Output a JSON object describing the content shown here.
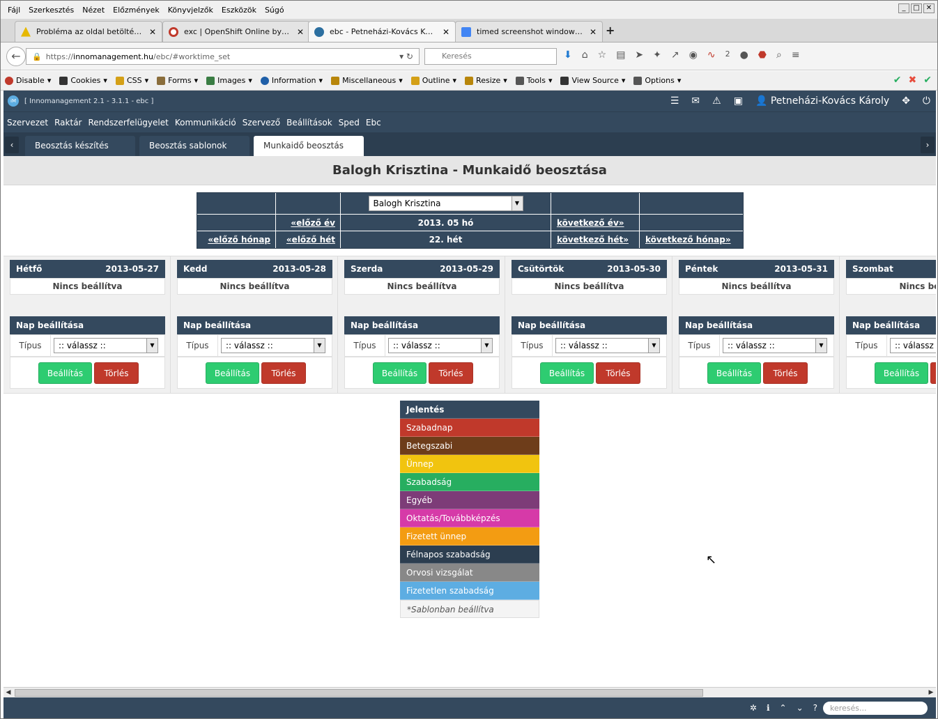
{
  "browser": {
    "menu": [
      "Fájl",
      "Szerkesztés",
      "Nézet",
      "Előzmények",
      "Könyvjelzők",
      "Eszközök",
      "Súgó"
    ],
    "tabs": [
      {
        "title": "Probléma az oldal betöltése k...",
        "icon_color": "#e6b800",
        "icon": "warning-icon"
      },
      {
        "title": "exc | OpenShift Online by Re...",
        "icon_color": "#c0392b",
        "icon": "openshift-icon"
      },
      {
        "title": "ebc - Petneházi-Kovács Károl...",
        "icon_color": "#2c6fa0",
        "icon": "innomanagement-icon"
      },
      {
        "title": "timed screenshot windows - G...",
        "icon_color": "#4285f4",
        "icon": "google-icon"
      }
    ],
    "new_tab": "+",
    "url_prefix": "https://",
    "url_domain": "innomanagement.hu",
    "url_path": "/ebc/#worktime_set",
    "search_placeholder": "Keresés",
    "nav_badge": "2"
  },
  "webdev": [
    {
      "label": "Disable",
      "color": "#c0392b"
    },
    {
      "label": "Cookies",
      "color": "#333333"
    },
    {
      "label": "CSS",
      "color": "#d4a017"
    },
    {
      "label": "Forms",
      "color": "#8a6d3b"
    },
    {
      "label": "Images",
      "color": "#3a7d44"
    },
    {
      "label": "Information",
      "color": "#1f5fa8"
    },
    {
      "label": "Miscellaneous",
      "color": "#b8860b"
    },
    {
      "label": "Outline",
      "color": "#d4a017"
    },
    {
      "label": "Resize",
      "color": "#b8860b"
    },
    {
      "label": "Tools",
      "color": "#555555"
    },
    {
      "label": "View Source",
      "color": "#333333"
    },
    {
      "label": "Options",
      "color": "#555555"
    }
  ],
  "app": {
    "version": "[ Innomanagement 2.1 - 3.1.1 - ebc ]",
    "logo": "iM",
    "user": "Petneházi-Kovács Károly",
    "menu": [
      "Szervezet",
      "Raktár",
      "Rendszerfelügyelet",
      "Kommunikáció",
      "Szervező",
      "Beállítások",
      "Sped",
      "Ebc"
    ],
    "subtabs": [
      "Beosztás készítés",
      "Beosztás sablonok",
      "Munkaidő beosztás"
    ],
    "colors": {
      "primary": "#34495e",
      "dark": "#2c3e50",
      "green": "#2ecc71",
      "red": "#c0392b"
    }
  },
  "page": {
    "title": "Balogh Krisztina - Munkaidő beosztása",
    "person_select": "Balogh Krisztina",
    "prev_year": "«előző év",
    "period": "2013. 05 hó",
    "next_year": "következő év»",
    "prev_month": "«előző hónap",
    "prev_week": "«előző hét",
    "week": "22. hét",
    "next_week": "következő hét»",
    "next_month": "következő hónap»"
  },
  "days": [
    {
      "name": "Hétfő",
      "date": "2013-05-27",
      "status": "Nincs beállítva"
    },
    {
      "name": "Kedd",
      "date": "2013-05-28",
      "status": "Nincs beállítva"
    },
    {
      "name": "Szerda",
      "date": "2013-05-29",
      "status": "Nincs beállítva"
    },
    {
      "name": "Csütörtök",
      "date": "2013-05-30",
      "status": "Nincs beállítva"
    },
    {
      "name": "Péntek",
      "date": "2013-05-31",
      "status": "Nincs beállítva"
    },
    {
      "name": "Szombat",
      "date": "",
      "status": "Nincs beál"
    }
  ],
  "day_form": {
    "header": "Nap beállítása",
    "type_label": "Típus",
    "type_value": ":: válassz ::",
    "set_label": "Beállítás",
    "delete_label": "Törlés"
  },
  "legend": {
    "title": "Jelentés",
    "items": [
      {
        "label": "Szabadnap",
        "color": "#c0392b"
      },
      {
        "label": "Betegszabi",
        "color": "#6e3d1a"
      },
      {
        "label": "Ünnep",
        "color": "#f1c40f"
      },
      {
        "label": "Szabadság",
        "color": "#27ae60"
      },
      {
        "label": "Egyéb",
        "color": "#7d3c78"
      },
      {
        "label": "Oktatás/Továbbképzés",
        "color": "#d63aa8"
      },
      {
        "label": "Fizetett ünnep",
        "color": "#f39c12"
      },
      {
        "label": "Félnapos szabadság",
        "color": "#2c3e50"
      },
      {
        "label": "Orvosi vizsgálat",
        "color": "#888888"
      },
      {
        "label": "Fizetetlen szabadság",
        "color": "#5dade2"
      }
    ],
    "note": "*Sablonban beállítva"
  },
  "footer": {
    "search_placeholder": "keresés..."
  }
}
